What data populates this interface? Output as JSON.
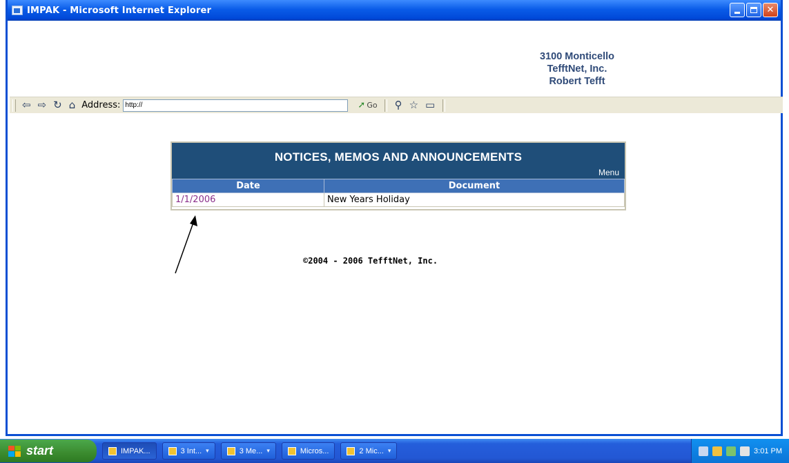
{
  "window": {
    "title": "IMPAK - Microsoft Internet Explorer",
    "buttons": {
      "minimize": "",
      "maximize": "",
      "close": "✕"
    }
  },
  "header": {
    "line1": "3100 Monticello",
    "line2": "TefftNet, Inc.",
    "line3": "Robert Tefft"
  },
  "toolbar": {
    "address_label": "Address:",
    "address_value": "http://",
    "go_label": "Go",
    "icons": [
      "back-icon",
      "forward-icon",
      "refresh-icon",
      "home-icon",
      "search-icon",
      "favorites-icon",
      "history-icon"
    ]
  },
  "notices": {
    "title": "NOTICES, MEMOS AND ANNOUNCEMENTS",
    "menu_label": "Menu",
    "columns": [
      "Date",
      "Document"
    ],
    "rows": [
      {
        "date": "1/1/2006",
        "document": "New Years Holiday"
      }
    ]
  },
  "footer": {
    "copyright": "©2004 - 2006 TefftNet, Inc."
  },
  "taskbar": {
    "start_label": "start",
    "tasks": [
      {
        "label": "IMPAK..."
      },
      {
        "label": "3 Int..."
      },
      {
        "label": "3 Me..."
      },
      {
        "label": "Micros..."
      },
      {
        "label": "2 Mic..."
      }
    ],
    "clock": "3:01 PM"
  },
  "colors": {
    "panel_header": "#1f4e79",
    "table_header": "#3e70b6",
    "date_link": "#8a2f8a",
    "header_text": "#2f4a78",
    "titlebar": "#0a5ce8",
    "taskbar": "#245edb",
    "start_button": "#3b8b2f"
  }
}
